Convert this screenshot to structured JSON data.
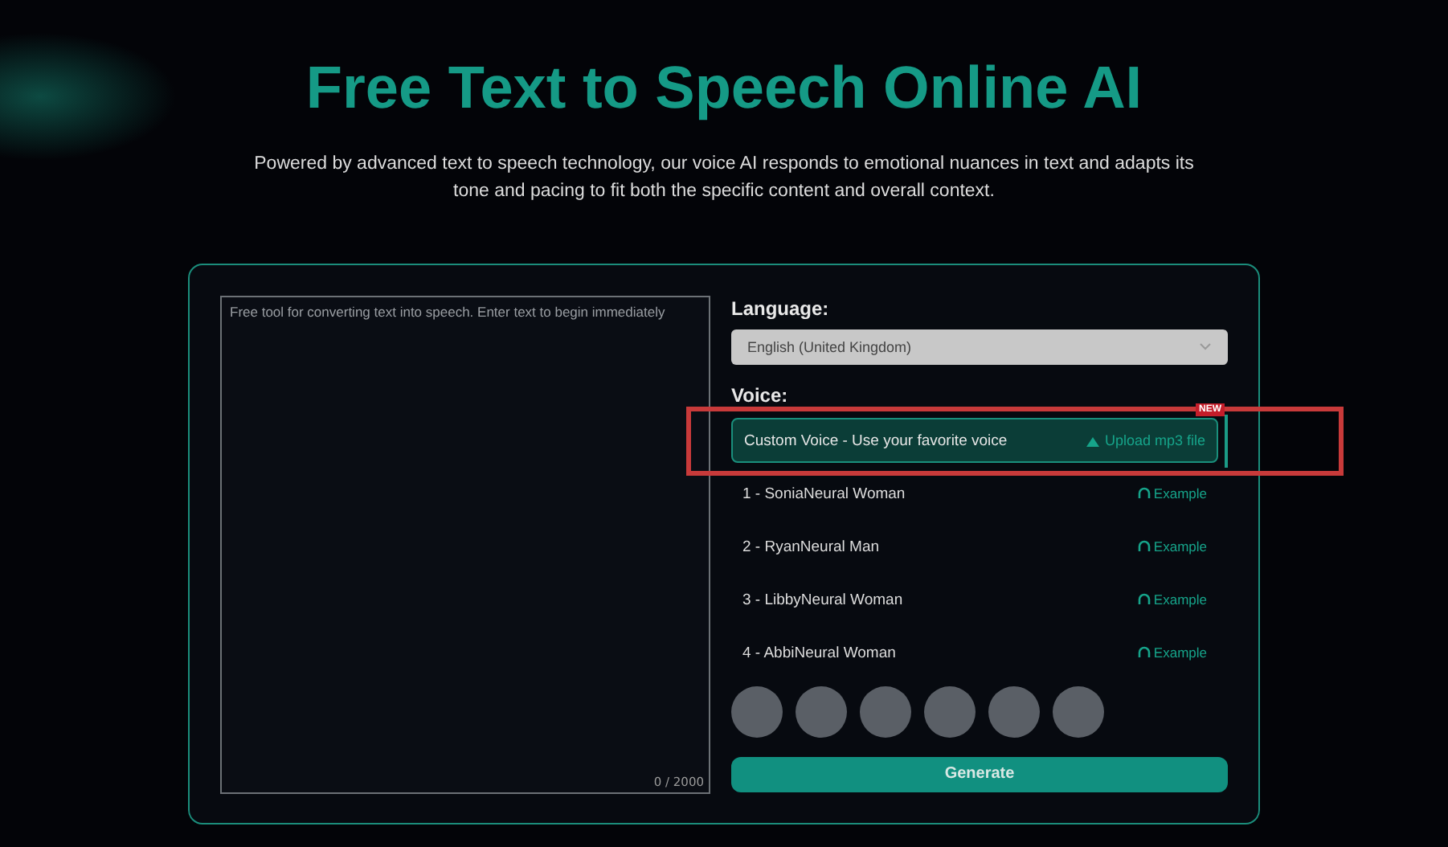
{
  "title": "Free Text to Speech Online AI",
  "subtitle": "Powered by advanced text to speech technology, our voice AI responds to emotional nuances in text and adapts its tone and pacing to fit both the specific content and overall context.",
  "text_input": {
    "placeholder": "Free tool for converting text into speech. Enter text to begin immediately",
    "counter": "0 / 2000"
  },
  "language": {
    "label": "Language:",
    "value": "English (United Kingdom)"
  },
  "voice": {
    "label": "Voice:",
    "custom": {
      "label": "Custom Voice - Use your favorite voice",
      "action": "Upload mp3 file",
      "badge": "NEW",
      "highlighted": true
    },
    "items": [
      {
        "name": "1 - SoniaNeural Woman",
        "action": "Example"
      },
      {
        "name": "2 - RyanNeural Man",
        "action": "Example"
      },
      {
        "name": "3 - LibbyNeural Woman",
        "action": "Example"
      },
      {
        "name": "4 - AbbiNeural Woman",
        "action": "Example"
      }
    ]
  },
  "generate_button": "Generate"
}
